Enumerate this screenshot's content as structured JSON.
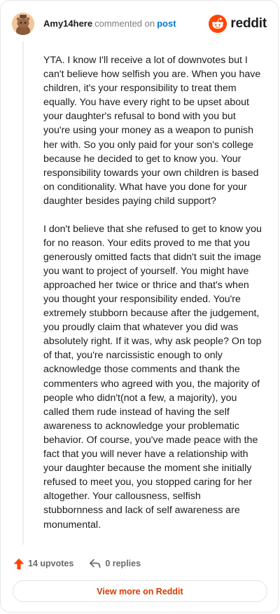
{
  "header": {
    "username": "Amy14here",
    "commented_text": "commented on",
    "post_link": "post",
    "brand": "reddit"
  },
  "comment": {
    "paragraphs": [
      "YTA. I know I'll receive a lot of downvotes but I can't believe how selfish you are. When you have children, it's your responsibility to treat them equally. You have every right to be upset about your daughter's refusal to bond with you but you're using your money as a weapon to punish her with. So you only paid for your son's college because he decided to get to know you. Your responsibility towards your own children is based on conditionality. What have you done for your daughter besides paying child support?",
      "I don't believe that she refused to get to know you for no reason. Your edits proved to me that you generously omitted facts that didn't suit the image you want to project of yourself. You might have approached her twice or thrice and that's when you thought your responsibility ended. You're extremely stubborn because after the judgement, you proudly claim that whatever you did was absolutely right. If it was, why ask people? On top of that, you're narcissistic enough to only acknowledge those comments and thank the commenters who agreed with you, the majority of people who didn't(not a few, a majority), you called them rude instead of having the self awareness to acknowledge your problematic behavior. Of course, you've made peace with the fact that you will never have a relationship with your daughter because the moment she initially refused to meet you, you stopped caring for her altogether. Your callousness, selfish stubbornness and lack of self awareness are monumental."
    ]
  },
  "actions": {
    "upvotes": "14 upvotes",
    "replies": "0 replies"
  },
  "footer": {
    "view_more": "View more on Reddit"
  },
  "colors": {
    "reddit_orange": "#ff4500",
    "link_blue": "#0079d3",
    "view_more_text": "#d93a00"
  },
  "icons": {
    "avatar": "snoo-avatar",
    "logo": "reddit-snoo-icon",
    "upvote": "upvote-arrow-icon",
    "reply": "reply-arrow-icon"
  }
}
